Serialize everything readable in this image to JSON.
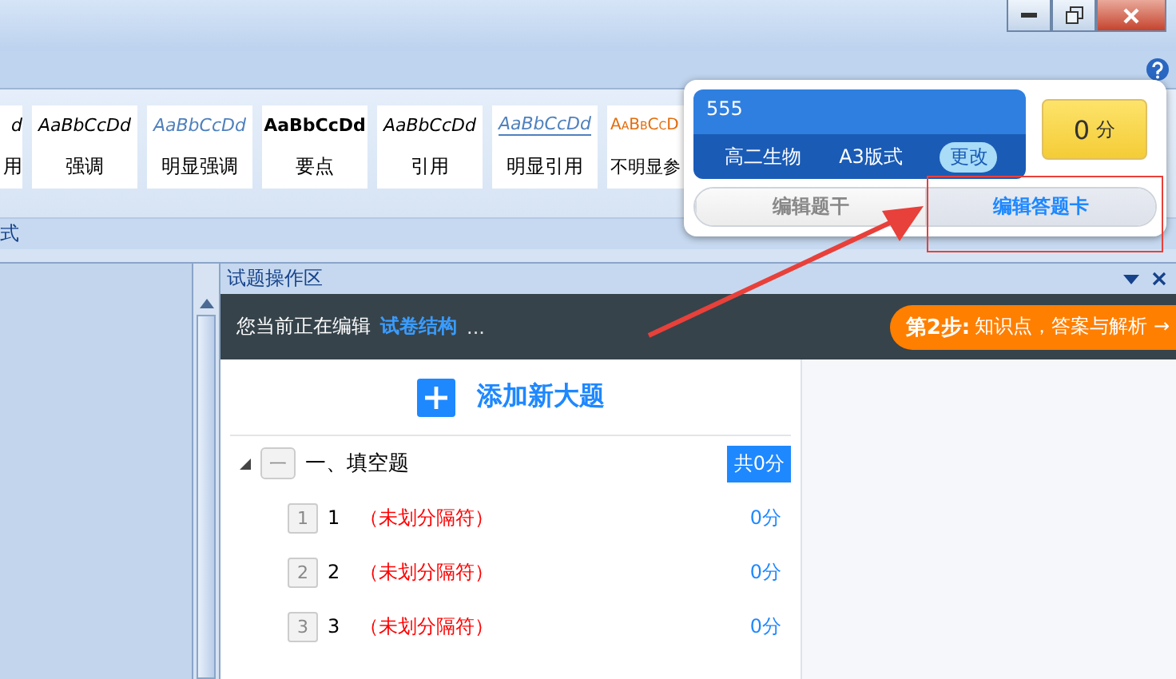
{
  "styles": [
    {
      "sample": "d",
      "label": "用",
      "kind": "italic"
    },
    {
      "sample": "AaBbCcDd",
      "label": "强调",
      "kind": "italic"
    },
    {
      "sample": "AaBbCcDd",
      "label": "明显强调",
      "kind": "blue-italic"
    },
    {
      "sample": "AaBbCcDd",
      "label": "要点",
      "kind": "bold"
    },
    {
      "sample": "AaBbCcDd",
      "label": "引用",
      "kind": "italic"
    },
    {
      "sample": "AaBbCcDd",
      "label": "明显引用",
      "kind": "blue-underline"
    },
    {
      "sample": "AaBbCcD",
      "label": "不明显参",
      "kind": "orange-caps"
    }
  ],
  "ribbon_group": "式",
  "popup": {
    "code": "555",
    "subject": "高二生物",
    "format": "A3版式",
    "change_button": "更改",
    "score": "0",
    "score_unit": "分",
    "tabs": [
      {
        "label": "编辑题干",
        "selected": false
      },
      {
        "label": "编辑答题卡",
        "selected": true
      }
    ]
  },
  "panel": {
    "title": "试题操作区",
    "status_prefix": "您当前正在编辑",
    "status_target": "试卷结构",
    "status_suffix": "...",
    "next_step": {
      "step": "第2步:",
      "text": "知识点，答案与解析 →"
    },
    "add_button": "添加新大题",
    "sections": [
      {
        "marker": "一",
        "title": "一、填空题",
        "total": "共0分",
        "expanded": true,
        "children": [
          {
            "index": "1",
            "number": "1",
            "note": "（未划分隔符）",
            "score": "0分"
          },
          {
            "index": "2",
            "number": "2",
            "note": "（未划分隔符）",
            "score": "0分"
          },
          {
            "index": "3",
            "number": "3",
            "note": "（未划分隔符）",
            "score": "0分"
          }
        ]
      }
    ]
  }
}
